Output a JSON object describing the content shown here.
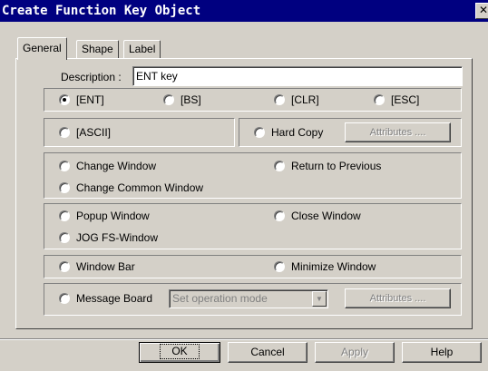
{
  "title": "Create Function Key  Object",
  "close_glyph": "✕",
  "tabs": [
    {
      "label": "General",
      "active": true
    },
    {
      "label": "Shape",
      "active": false
    },
    {
      "label": "Label",
      "active": false
    }
  ],
  "description": {
    "label": "Description :",
    "value": "ENT key"
  },
  "key_options": [
    {
      "label": "[ENT]",
      "selected": true
    },
    {
      "label": "[BS]",
      "selected": false
    },
    {
      "label": "[CLR]",
      "selected": false
    },
    {
      "label": "[ESC]",
      "selected": false
    }
  ],
  "ascii": {
    "label": "[ASCII]",
    "selected": false
  },
  "hardcopy": {
    "label": "Hard Copy",
    "selected": false,
    "attributes_label": "Attributes ....",
    "attributes_enabled": false
  },
  "window_options": {
    "change_window": "Change Window",
    "return_to_previous": "Return to Previous",
    "change_common_window": "Change Common Window"
  },
  "popup_options": {
    "popup_window": "Popup Window",
    "close_window": "Close Window",
    "jog_fs_window": "JOG FS-Window"
  },
  "bar_options": {
    "window_bar": "Window Bar",
    "minimize_window": "Minimize Window"
  },
  "message_board": {
    "label": "Message Board",
    "combo_value": "Set operation mode",
    "combo_enabled": false,
    "attributes_label": "Attributes ....",
    "attributes_enabled": false
  },
  "footer": {
    "ok": "OK",
    "cancel": "Cancel",
    "apply": "Apply",
    "help": "Help"
  },
  "icons": {
    "radio": "radio-button",
    "dropdown": "chevron-down-icon",
    "close": "close-icon"
  }
}
